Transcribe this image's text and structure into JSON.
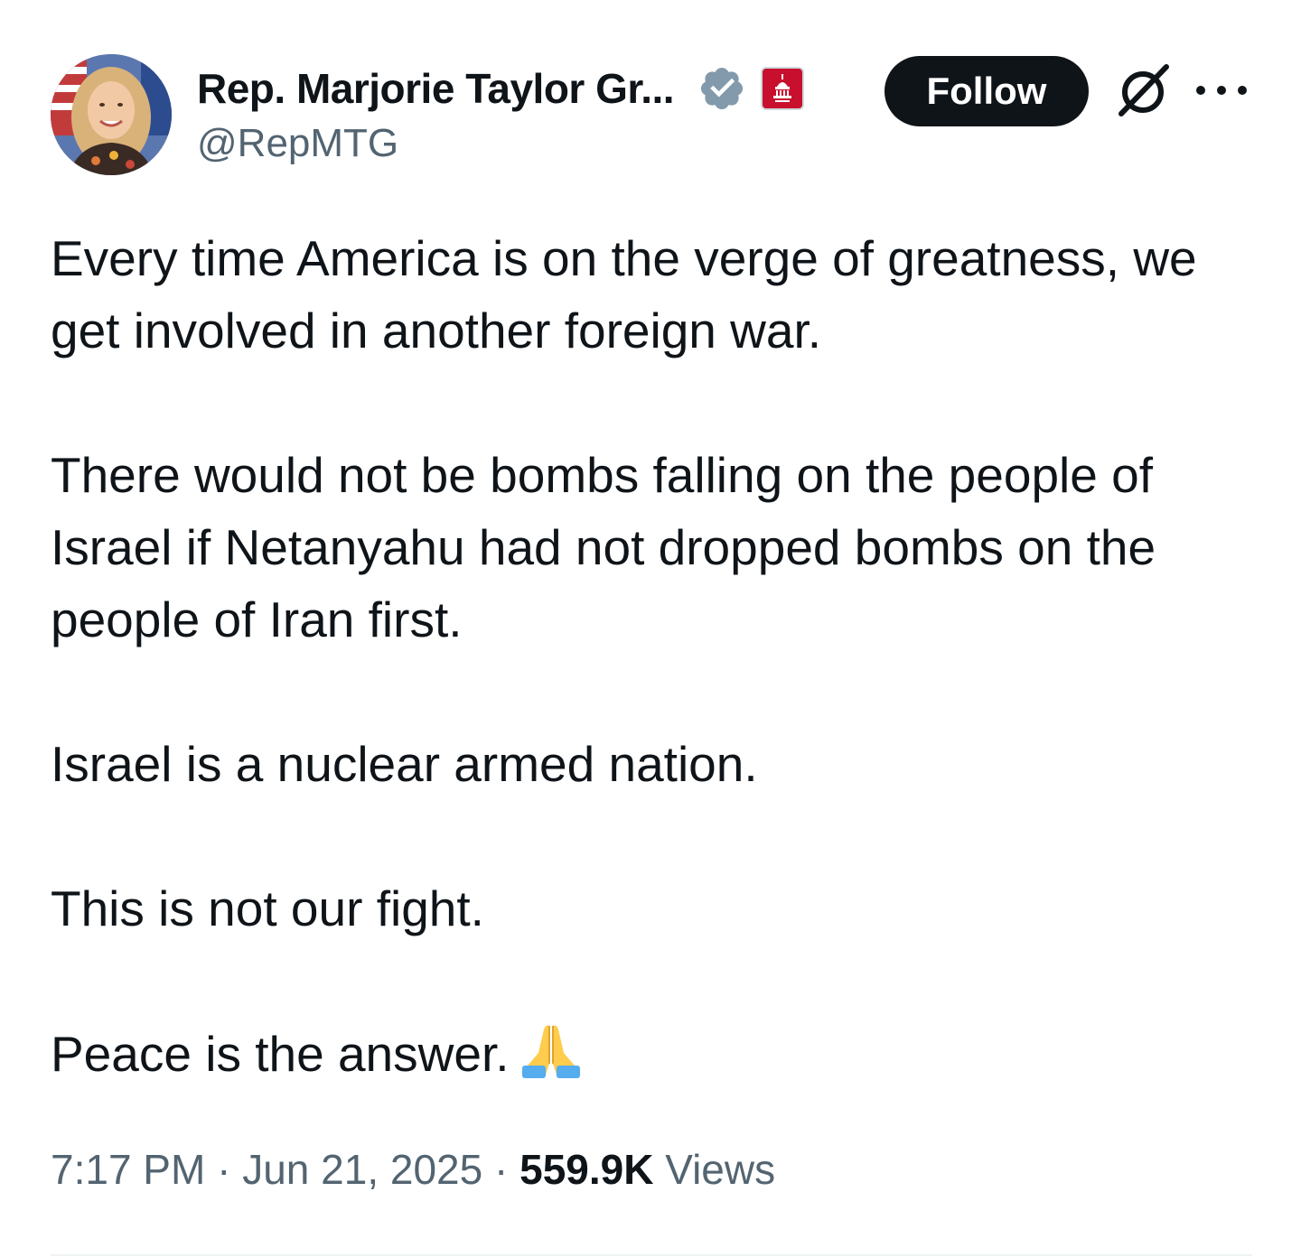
{
  "author": {
    "display_name": "Rep. Marjorie Taylor Gr...",
    "handle": "@RepMTG",
    "avatar": "avatar-photo",
    "verified_badge": "verified-badge-icon",
    "verified_color": "#829aab",
    "affiliate_badge": "house-gop-badge-icon",
    "affiliate_color": "#c8102e"
  },
  "actions": {
    "follow_label": "Follow",
    "grok_icon": "grok-icon",
    "more_icon": "more-options-icon"
  },
  "tweet": {
    "paragraphs": [
      "Every time America is on the verge of greatness, we get involved in another foreign war.",
      "There would not be bombs falling on the people of Israel if Netanyahu had not dropped bombs on the people of Iran first.",
      "Israel is a nuclear armed nation.",
      "This is not our fight.",
      "Peace is the answer."
    ],
    "emoji_icon": "folded-hands-emoji"
  },
  "meta": {
    "time": "7:17 PM",
    "separator": "·",
    "date": "Jun 21, 2025",
    "views_count": "559.9K",
    "views_label": "Views"
  },
  "colors": {
    "text_primary": "#0f1419",
    "text_secondary": "#536471",
    "follow_bg": "#0f1419",
    "follow_text": "#ffffff"
  }
}
